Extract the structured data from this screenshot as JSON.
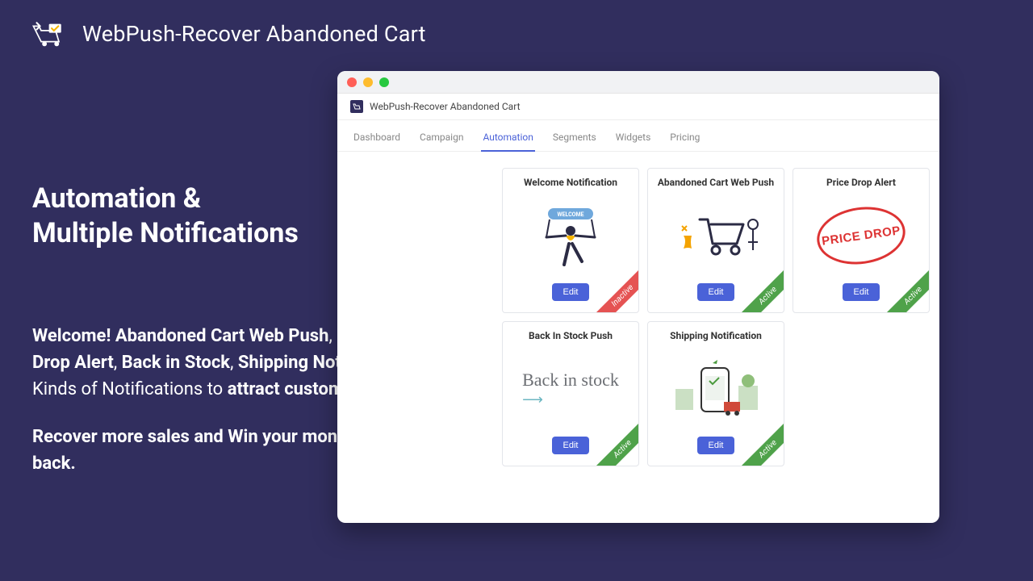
{
  "brand": {
    "title": "WebPush-Recover Abandoned Cart"
  },
  "headline_line1": "Automation &",
  "headline_line2": "Multiple Notifications",
  "body": {
    "p1_prefix": "Welcome! Abandoned Cart Web Push",
    "p1_mid": ", ",
    "p1_item2": "Price Drop Alert",
    "p1_mid2": ", ",
    "p1_item3": "Back in Stock",
    "p1_mid3": ", ",
    "p1_item4": "Shipping Notify",
    "p1_after": ". Kinds of Notifications to ",
    "p1_strong2": "attract customers",
    "p1_end": ".",
    "p2": "Recover more sales and Win your money back."
  },
  "window": {
    "app_title": "WebPush-Recover Abandoned Cart",
    "tabs": [
      "Dashboard",
      "Campaign",
      "Automation",
      "Segments",
      "Widgets",
      "Pricing"
    ],
    "active_tab_index": 2,
    "edit_label": "Edit",
    "status_active": "Active",
    "status_inactive": "Inactive",
    "cards": [
      {
        "title": "Welcome Notification",
        "status": "Inactive"
      },
      {
        "title": "Abandoned Cart Web Push",
        "status": "Active"
      },
      {
        "title": "Price Drop Alert",
        "status": "Active",
        "stamp_text": "PRICE DROP"
      },
      {
        "title": "Back In Stock Push",
        "status": "Active",
        "script_text": "Back in stock"
      },
      {
        "title": "Shipping Notification",
        "status": "Active"
      }
    ]
  }
}
